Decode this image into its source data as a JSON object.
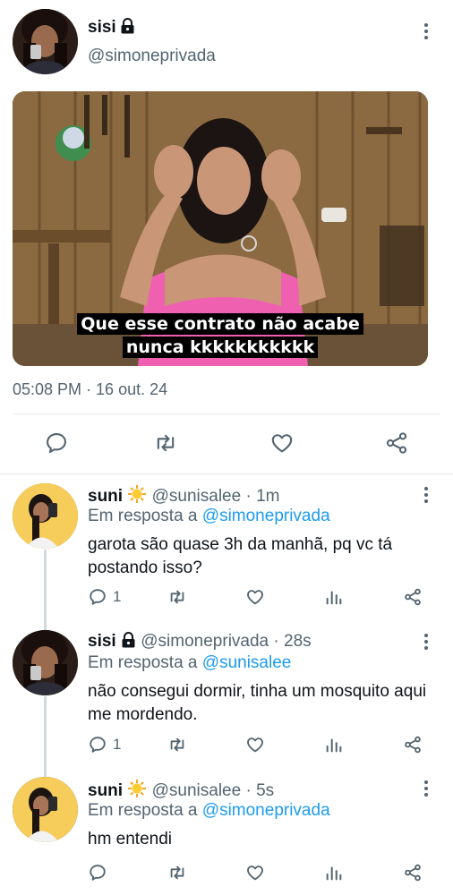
{
  "main_tweet": {
    "display_name": "sisi",
    "handle": "@simoneprivada",
    "media": {
      "subtitle_line1": "Que esse contrato não acabe",
      "subtitle_line2": "nunca kkkkkkkkkkk"
    },
    "timestamp": "05:08 PM · 16 out. 24"
  },
  "replies": [
    {
      "display_name": "suni",
      "handle_time": "@sunisalee · 1m",
      "in_reply_prefix": "Em resposta a",
      "in_reply_mention": "@simoneprivada",
      "text": "garota são quase 3h da manhã, pq vc tá postando isso?",
      "reply_count": "1"
    },
    {
      "display_name": "sisi",
      "handle_time": "@simoneprivada · 28s",
      "in_reply_prefix": "Em resposta a",
      "in_reply_mention": "@sunisalee",
      "text": "não consegui dormir, tinha um mosquito aqui me mordendo.",
      "reply_count": "1"
    },
    {
      "display_name": "suni",
      "handle_time": "@sunisalee · 5s",
      "in_reply_prefix": "Em resposta a",
      "in_reply_mention": "@simoneprivada",
      "text": "hm entendi",
      "reply_count": ""
    }
  ],
  "icons": {
    "reply": "reply-icon",
    "retweet": "retweet-icon",
    "like": "like-icon",
    "share": "share-icon",
    "analytics": "analytics-icon",
    "more": "more-vertical-icon",
    "lock": "lock-icon",
    "sun_emoji": "sun-emoji-icon"
  },
  "colors": {
    "text": "#0f1419",
    "secondary": "#536471",
    "link": "#1d9bf0",
    "divider": "#e1e6ea"
  }
}
